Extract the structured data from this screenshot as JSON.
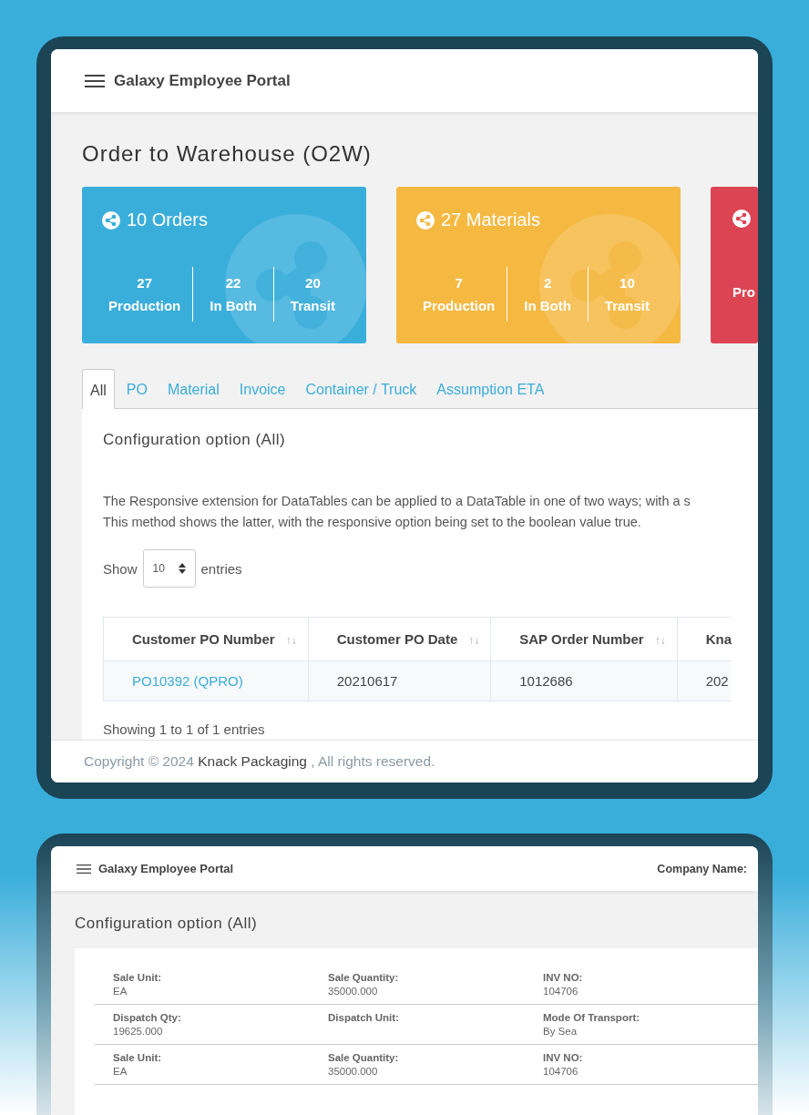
{
  "top_screen": {
    "header": {
      "title": "Galaxy Employee Portal"
    },
    "page_title": "Order to Warehouse (O2W)",
    "cards": [
      {
        "title": "10 Orders",
        "color": "#3aaedb",
        "stats": [
          {
            "value": "27",
            "label": "Production"
          },
          {
            "value": "22",
            "label": "In Both"
          },
          {
            "value": "20",
            "label": "Transit"
          }
        ]
      },
      {
        "title": "27 Materials",
        "color": "#f5b942",
        "stats": [
          {
            "value": "7",
            "label": "Production"
          },
          {
            "value": "2",
            "label": "In Both"
          },
          {
            "value": "10",
            "label": "Transit"
          }
        ]
      },
      {
        "color": "#dc4453",
        "stats": [
          {
            "label": "Pro"
          }
        ]
      }
    ],
    "tabs": [
      {
        "label": "All",
        "selected": true
      },
      {
        "label": "PO",
        "selected": false
      },
      {
        "label": "Material",
        "selected": false
      },
      {
        "label": "Invoice",
        "selected": false
      },
      {
        "label": "Container / Truck",
        "selected": false
      },
      {
        "label": "Assumption ETA",
        "selected": false
      }
    ],
    "panel": {
      "title": "Configuration option (All)",
      "description": [
        "The Responsive extension for DataTables can be applied to a DataTable in one of two ways; with a s",
        "This method shows the latter, with the responsive option being set to the boolean value true."
      ],
      "length": {
        "before": "Show",
        "value": "10",
        "after": "entries"
      },
      "table": {
        "columns": [
          {
            "label": "Customer PO Number",
            "sort": "↑↓"
          },
          {
            "label": "Customer PO Date",
            "sort": "↑↓"
          },
          {
            "label": "SAP Order Number",
            "sort": "↑↓"
          },
          {
            "label": "Kna"
          }
        ],
        "rows": [
          {
            "cells": [
              "PO10392 (QPRO)",
              "20210617",
              "1012686",
              "202"
            ]
          }
        ]
      },
      "info": "Showing 1 to 1 of 1 entries"
    },
    "footer": {
      "prefix": "Copyright © 2024 ",
      "link": "Knack Packaging",
      "suffix": " , All rights reserved."
    }
  },
  "bottom_screen": {
    "header": {
      "title": "Galaxy Employee Portal",
      "company_label": "Company Name:"
    },
    "page_title": "Configuration option (All)",
    "detail_rows": [
      [
        {
          "label": "Sale Unit:",
          "value": "EA"
        },
        {
          "label": "Sale Quantity:",
          "value": "35000.000"
        },
        {
          "label": "INV NO:",
          "value": "104706"
        }
      ],
      [
        {
          "label": "Dispatch Qty:",
          "value": "19625.000"
        },
        {
          "label": "Dispatch Unit:"
        },
        {
          "label": "Mode Of Transport:",
          "value": "By Sea"
        }
      ],
      [
        {
          "label": "Sale Unit:",
          "value": "EA"
        },
        {
          "label": "Sale Quantity:",
          "value": "35000.000"
        },
        {
          "label": "INV NO:",
          "value": "104706"
        }
      ]
    ]
  }
}
